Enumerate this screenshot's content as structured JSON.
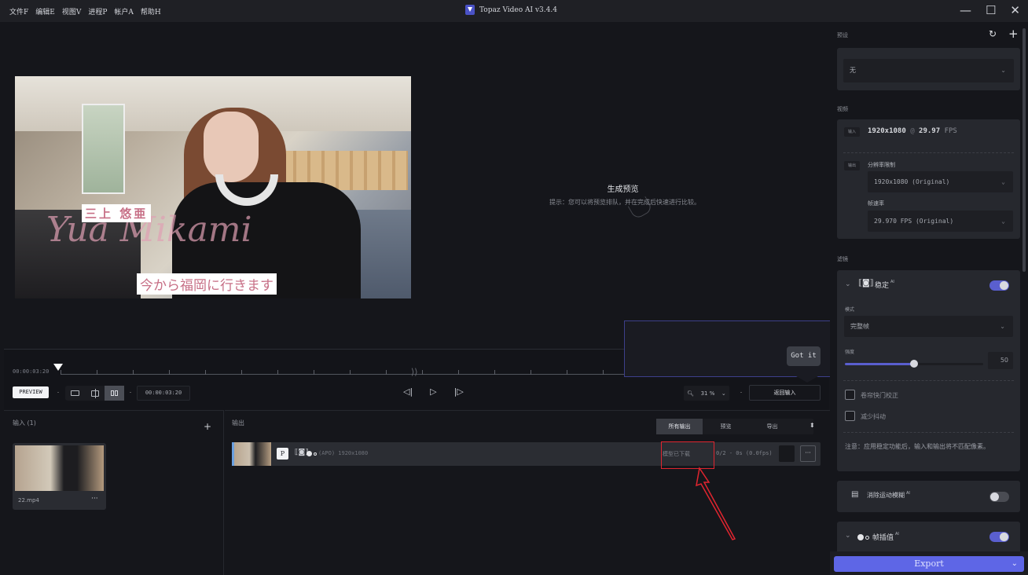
{
  "titlebar": {
    "menu": [
      "文件F",
      "编辑E",
      "视图V",
      "进程P",
      "帐户A",
      "帮助H"
    ],
    "app_title": "Topaz Video AI  v3.4.4",
    "controls": {
      "minimize": "—",
      "maximize": "☐",
      "close": "✕"
    }
  },
  "preview": {
    "generate_title": "生成预览",
    "generate_hint": "提示：您可以将预览排队，并在完成后快速进行比较。",
    "video_caption_name": "三上 悠亜",
    "video_caption_line": "今から福岡に行きます",
    "video_script_text": "Yua Mikami"
  },
  "timeline": {
    "current_time": "00:00:03:20",
    "preview_label": "PREVIEW",
    "time_field": "00:00:03:20",
    "view_modes": [
      "single-view",
      "split-view",
      "side-by-side"
    ],
    "active_view": "side-by-side",
    "zoom_value": "31 %",
    "back_to_input_label": "返回输入"
  },
  "tooltip": {
    "got_it_label": "Got it"
  },
  "input_panel": {
    "title": "输入 (1)",
    "add_label": "+",
    "items": [
      {
        "name": "22.mp4",
        "more_label": "···"
      }
    ]
  },
  "output_panel": {
    "title": "输出",
    "tabs": [
      {
        "label": "所有输出",
        "active": true
      },
      {
        "label": "预览",
        "active": false
      },
      {
        "label": "导出",
        "active": false
      }
    ],
    "rows": [
      {
        "badge": "P",
        "description": "(APO) 1920x1080",
        "status": "模型已下载",
        "progress": "0/2 - 0s (0.0fps)",
        "more_label": "···"
      }
    ]
  },
  "sidebar": {
    "presets_label": "预设",
    "preset_value": "无",
    "video_label": "视频",
    "input_tag": "输入",
    "input_res": "1920x1080",
    "input_at": "@",
    "input_fps": "29.97",
    "input_fps_unit": "FPS",
    "output_tag": "输出",
    "resolution_label": "分辨率限制",
    "resolution_value": "1920x1080 (Original)",
    "framerate_label": "帧速率",
    "framerate_value": "29.970 FPS (Original)",
    "filters_label": "滤镜",
    "stabilize": {
      "title": "稳定",
      "ai": "AI",
      "enabled": true,
      "mode_label": "模式",
      "mode_value": "完整帧",
      "strength_label": "强度",
      "strength_value": "50",
      "strength_fraction": 0.5,
      "rolling_shutter_label": "卷帘快门校正",
      "rolling_shutter_checked": false,
      "reduce_jitter_label": "减少抖动",
      "reduce_jitter_checked": false,
      "note": "注意：应用稳定功能后，输入和输出将不匹配像素。"
    },
    "motion_deblur": {
      "title": "消除运动模糊",
      "ai": "AI",
      "enabled": false
    },
    "frame_interp": {
      "title": "帧插值",
      "ai": "AI",
      "enabled": true
    },
    "export_label": "Export"
  },
  "colors": {
    "accent": "#5e66e6",
    "toggle_on": "#5a5fcf",
    "annotation": "#e0252f",
    "background": "#15161b",
    "card": "#26282e"
  }
}
